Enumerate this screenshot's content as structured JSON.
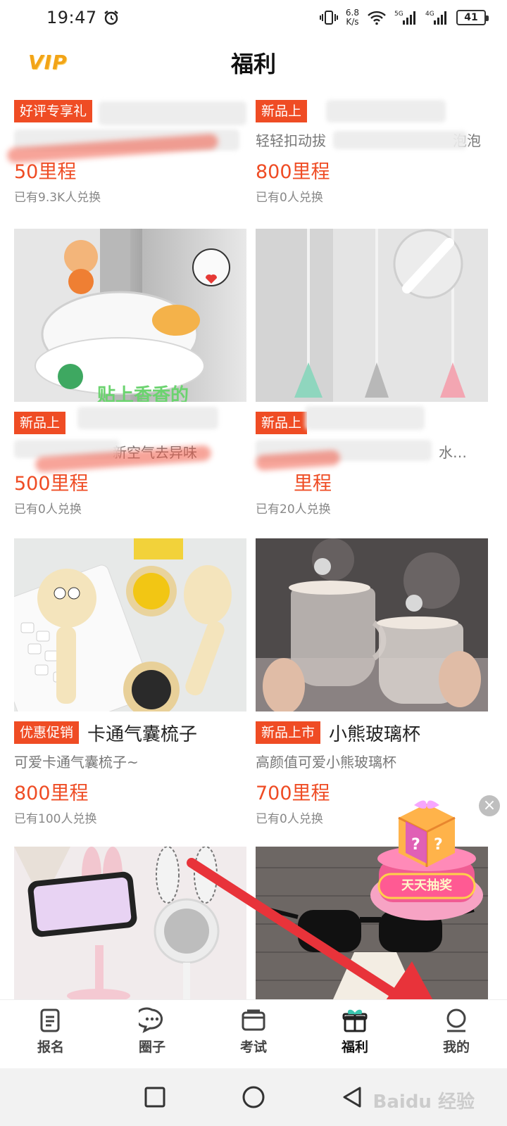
{
  "status_bar": {
    "time": "19:47",
    "net_speed_value": "6.8",
    "net_speed_unit": "K/s",
    "battery": "41",
    "icons": [
      "alarm-icon",
      "vibrate-icon",
      "wifi-icon",
      "signal-5g-icon",
      "signal-4g-icon",
      "battery-icon"
    ]
  },
  "header": {
    "vip_label": "VIP",
    "title": "福利"
  },
  "products": [
    {
      "tag": "好评专享礼",
      "title": "",
      "subtitle": "",
      "price": "50里程",
      "count": "已有9.3K人兑换"
    },
    {
      "tag": "新品上",
      "title": "",
      "subtitle": "轻轻扣动拔",
      "subtitle_end": "泡泡",
      "price": "800里程",
      "count": "已有0人兑换"
    },
    {
      "tag": "新品上",
      "title": "",
      "subtitle": "新空气去异味",
      "price": "500里程",
      "count": "已有0人兑换"
    },
    {
      "tag": "新品上",
      "title": "",
      "subtitle": "水…",
      "price": "里程",
      "count": "已有20人兑换"
    },
    {
      "tag": "优惠促销",
      "title": "卡通气囊梳子",
      "subtitle": "可爱卡通气囊梳子~",
      "price": "800里程",
      "count": "已有100人兑换"
    },
    {
      "tag": "新品上市",
      "title": "小熊玻璃杯",
      "subtitle": "高颜值可爱小熊玻璃杯",
      "price": "700里程",
      "count": "已有0人兑换"
    }
  ],
  "image_overlay_text": "贴上香香的",
  "lottery": {
    "label": "天天抽奖",
    "close": "×"
  },
  "tab_bar": [
    {
      "label": "报名",
      "icon": "document-icon"
    },
    {
      "label": "圈子",
      "icon": "chat-bubble-icon"
    },
    {
      "label": "考试",
      "icon": "card-icon"
    },
    {
      "label": "福利",
      "icon": "gift-icon",
      "active": true
    },
    {
      "label": "我的",
      "icon": "profile-icon"
    }
  ],
  "nav_bar": [
    "recent-apps-icon",
    "home-icon",
    "back-icon"
  ],
  "watermark": "Baidu 经验",
  "colors": {
    "accent": "#ef4c24",
    "vip": "#f2a417",
    "arrow": "#e8333a"
  }
}
